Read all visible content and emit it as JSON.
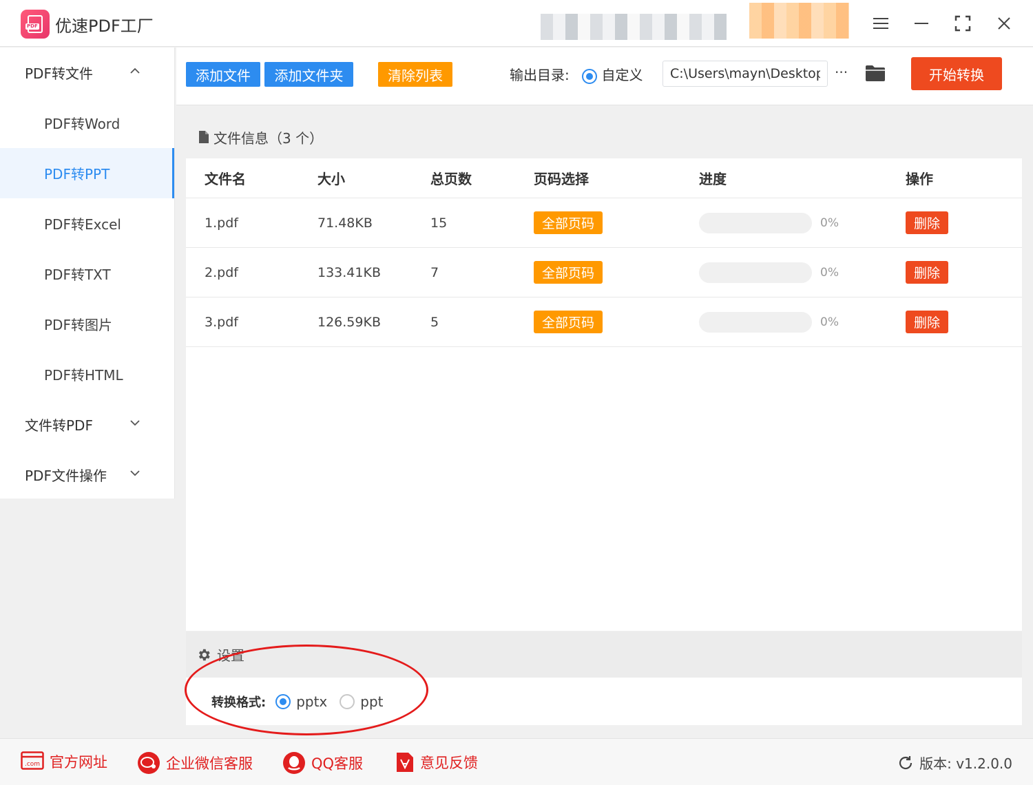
{
  "app": {
    "title": "优速PDF工厂",
    "logo_text": "PDF"
  },
  "sidebar": {
    "groups": [
      {
        "label": "PDF转文件",
        "expanded": true
      },
      {
        "label": "文件转PDF",
        "expanded": false
      },
      {
        "label": "PDF文件操作",
        "expanded": false
      }
    ],
    "items": [
      {
        "label": "PDF转Word"
      },
      {
        "label": "PDF转PPT",
        "active": true
      },
      {
        "label": "PDF转Excel"
      },
      {
        "label": "PDF转TXT"
      },
      {
        "label": "PDF转图片"
      },
      {
        "label": "PDF转HTML"
      }
    ]
  },
  "toolbar": {
    "add_file": "添加文件",
    "add_folder": "添加文件夹",
    "clear_list": "清除列表",
    "output_label": "输出目录:",
    "output_option": "自定义",
    "output_path": "C:\\Users\\mayn\\Desktop",
    "browse": "···",
    "start": "开始转换"
  },
  "file_panel": {
    "title": "文件信息（3 个）",
    "columns": [
      "文件名",
      "大小",
      "总页数",
      "页码选择",
      "进度",
      "操作"
    ],
    "rows": [
      {
        "name": "1.pdf",
        "size": "71.48KB",
        "pages": "15",
        "page_select": "全部页码",
        "progress": "0%",
        "progress_value": 0,
        "action": "删除"
      },
      {
        "name": "2.pdf",
        "size": "133.41KB",
        "pages": "7",
        "page_select": "全部页码",
        "progress": "0%",
        "progress_value": 0,
        "action": "删除"
      },
      {
        "name": "3.pdf",
        "size": "126.59KB",
        "pages": "5",
        "page_select": "全部页码",
        "progress": "0%",
        "progress_value": 0,
        "action": "删除"
      }
    ]
  },
  "settings": {
    "title": "设置",
    "format_label": "转换格式:",
    "options": [
      {
        "label": "pptx",
        "selected": true
      },
      {
        "label": "ppt",
        "selected": false
      }
    ]
  },
  "footer": {
    "links": [
      "官方网址",
      "企业微信客服",
      "QQ客服",
      "意见反馈"
    ],
    "version": "版本: v1.2.0.0"
  },
  "colors": {
    "primary": "#2d8cf0",
    "orange": "#ff9900",
    "danger": "#ee4a1f",
    "footer_link": "#e02020",
    "annotation": "#e41b1b"
  },
  "icons": [
    "pdf-app-icon",
    "menu-icon",
    "minimize-icon",
    "maximize-icon",
    "close-icon",
    "folder-icon",
    "file-icon",
    "gear-icon",
    "web-icon",
    "wechat-icon",
    "qq-icon",
    "feedback-icon",
    "refresh-icon"
  ]
}
